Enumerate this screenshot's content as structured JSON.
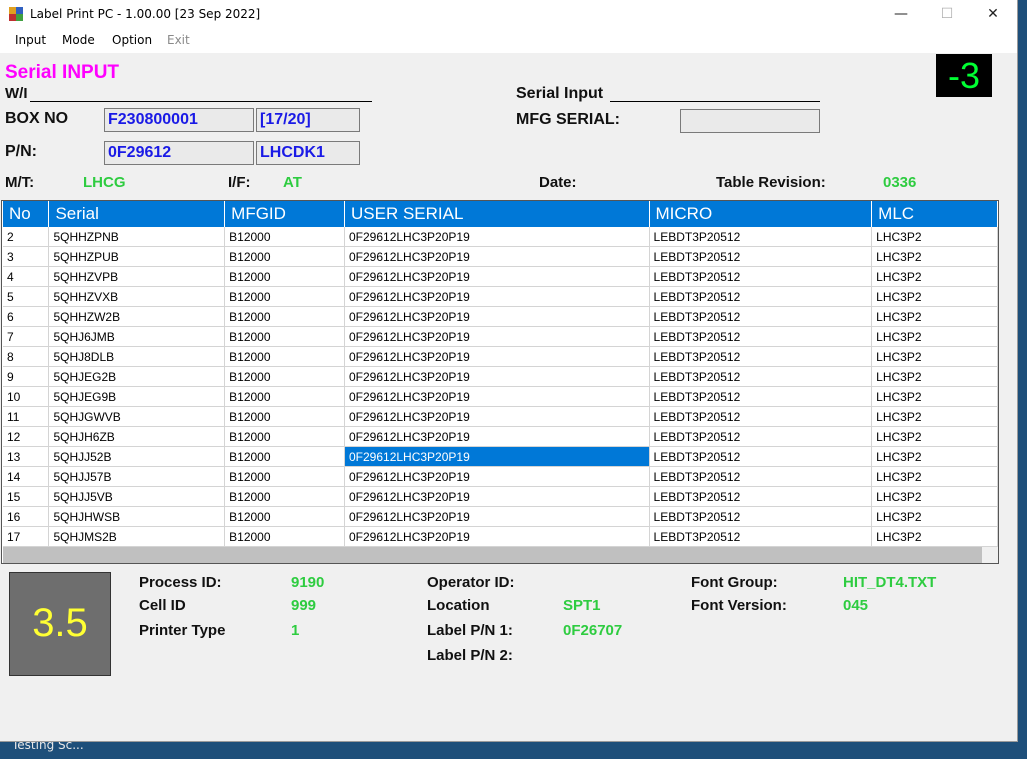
{
  "window": {
    "title": "Label Print PC - 1.00.00 [23 Sep 2022]",
    "controls": {
      "minimize": "—",
      "maximize": "☐",
      "close": "✕"
    }
  },
  "menu": [
    {
      "label": "Input",
      "enabled": true
    },
    {
      "label": "Mode",
      "enabled": true
    },
    {
      "label": "Option",
      "enabled": true
    },
    {
      "label": "Exit",
      "enabled": false
    }
  ],
  "header": {
    "title": "Serial INPUT",
    "wi_label": "W/I",
    "box_no_label": "BOX NO",
    "box_no_value": "F230800001",
    "box_count": "[17/20]",
    "pn_label": "P/N:",
    "pn_value": "0F29612",
    "pn_suffix": "LHCDK1",
    "serial_input_label": "Serial Input",
    "mfg_serial_label": "MFG SERIAL:",
    "mfg_serial_value": "",
    "counter": "-3",
    "mt_label": "M/T:",
    "mt_value": "LHCG",
    "if_label": "I/F:",
    "if_value": "AT",
    "date_label": "Date:",
    "date_value": "",
    "table_revision_label": "Table Revision:",
    "table_revision_value": "0336"
  },
  "grid": {
    "columns": [
      "No",
      "Serial",
      "MFGID",
      "USER SERIAL",
      "MICRO",
      "MLC"
    ],
    "rows": [
      [
        "2",
        "5QHHZPNB",
        "B12000",
        "0F29612LHC3P20P19",
        "LEBDT3P20512",
        "LHC3P2"
      ],
      [
        "3",
        "5QHHZPUB",
        "B12000",
        "0F29612LHC3P20P19",
        "LEBDT3P20512",
        "LHC3P2"
      ],
      [
        "4",
        "5QHHZVPB",
        "B12000",
        "0F29612LHC3P20P19",
        "LEBDT3P20512",
        "LHC3P2"
      ],
      [
        "5",
        "5QHHZVXB",
        "B12000",
        "0F29612LHC3P20P19",
        "LEBDT3P20512",
        "LHC3P2"
      ],
      [
        "6",
        "5QHHZW2B",
        "B12000",
        "0F29612LHC3P20P19",
        "LEBDT3P20512",
        "LHC3P2"
      ],
      [
        "7",
        "5QHJ6JMB",
        "B12000",
        "0F29612LHC3P20P19",
        "LEBDT3P20512",
        "LHC3P2"
      ],
      [
        "8",
        "5QHJ8DLB",
        "B12000",
        "0F29612LHC3P20P19",
        "LEBDT3P20512",
        "LHC3P2"
      ],
      [
        "9",
        "5QHJEG2B",
        "B12000",
        "0F29612LHC3P20P19",
        "LEBDT3P20512",
        "LHC3P2"
      ],
      [
        "10",
        "5QHJEG9B",
        "B12000",
        "0F29612LHC3P20P19",
        "LEBDT3P20512",
        "LHC3P2"
      ],
      [
        "11",
        "5QHJGWVB",
        "B12000",
        "0F29612LHC3P20P19",
        "LEBDT3P20512",
        "LHC3P2"
      ],
      [
        "12",
        "5QHJH6ZB",
        "B12000",
        "0F29612LHC3P20P19",
        "LEBDT3P20512",
        "LHC3P2"
      ],
      [
        "13",
        "5QHJJ52B",
        "B12000",
        "0F29612LHC3P20P19",
        "LEBDT3P20512",
        "LHC3P2"
      ],
      [
        "14",
        "5QHJJ57B",
        "B12000",
        "0F29612LHC3P20P19",
        "LEBDT3P20512",
        "LHC3P2"
      ],
      [
        "15",
        "5QHJJ5VB",
        "B12000",
        "0F29612LHC3P20P19",
        "LEBDT3P20512",
        "LHC3P2"
      ],
      [
        "16",
        "5QHJHWSB",
        "B12000",
        "0F29612LHC3P20P19",
        "LEBDT3P20512",
        "LHC3P2"
      ],
      [
        "17",
        "5QHJMS2B",
        "B12000",
        "0F29612LHC3P20P19",
        "LEBDT3P20512",
        "LHC3P2"
      ]
    ],
    "selected_row": "13",
    "selected_column": "USER SERIAL"
  },
  "status": {
    "big_value": "3.5",
    "process_id_label": "Process ID:",
    "process_id_value": "9190",
    "cell_id_label": "Cell ID",
    "cell_id_value": "999",
    "printer_type_label": "Printer Type",
    "printer_type_value": "1",
    "operator_id_label": "Operator ID:",
    "operator_id_value": "",
    "location_label": "Location",
    "location_value": "SPT1",
    "label_pn1_label": "Label P/N 1:",
    "label_pn1_value": "0F26707",
    "label_pn2_label": "Label P/N 2:",
    "label_pn2_value": "",
    "font_group_label": "Font Group:",
    "font_group_value": "HIT_DT4.TXT",
    "font_version_label": "Font Version:",
    "font_version_value": "045"
  },
  "desktop": {
    "taskbar_text": "Testing Sc..."
  },
  "colors": {
    "heading": "#ff00ff",
    "value_green": "#2ecc40",
    "field_text": "#1a1ae6",
    "grid_header": "#0078d7",
    "counter_bg": "#000000",
    "counter_fg": "#00ff33",
    "big_fg": "#ffff33"
  }
}
